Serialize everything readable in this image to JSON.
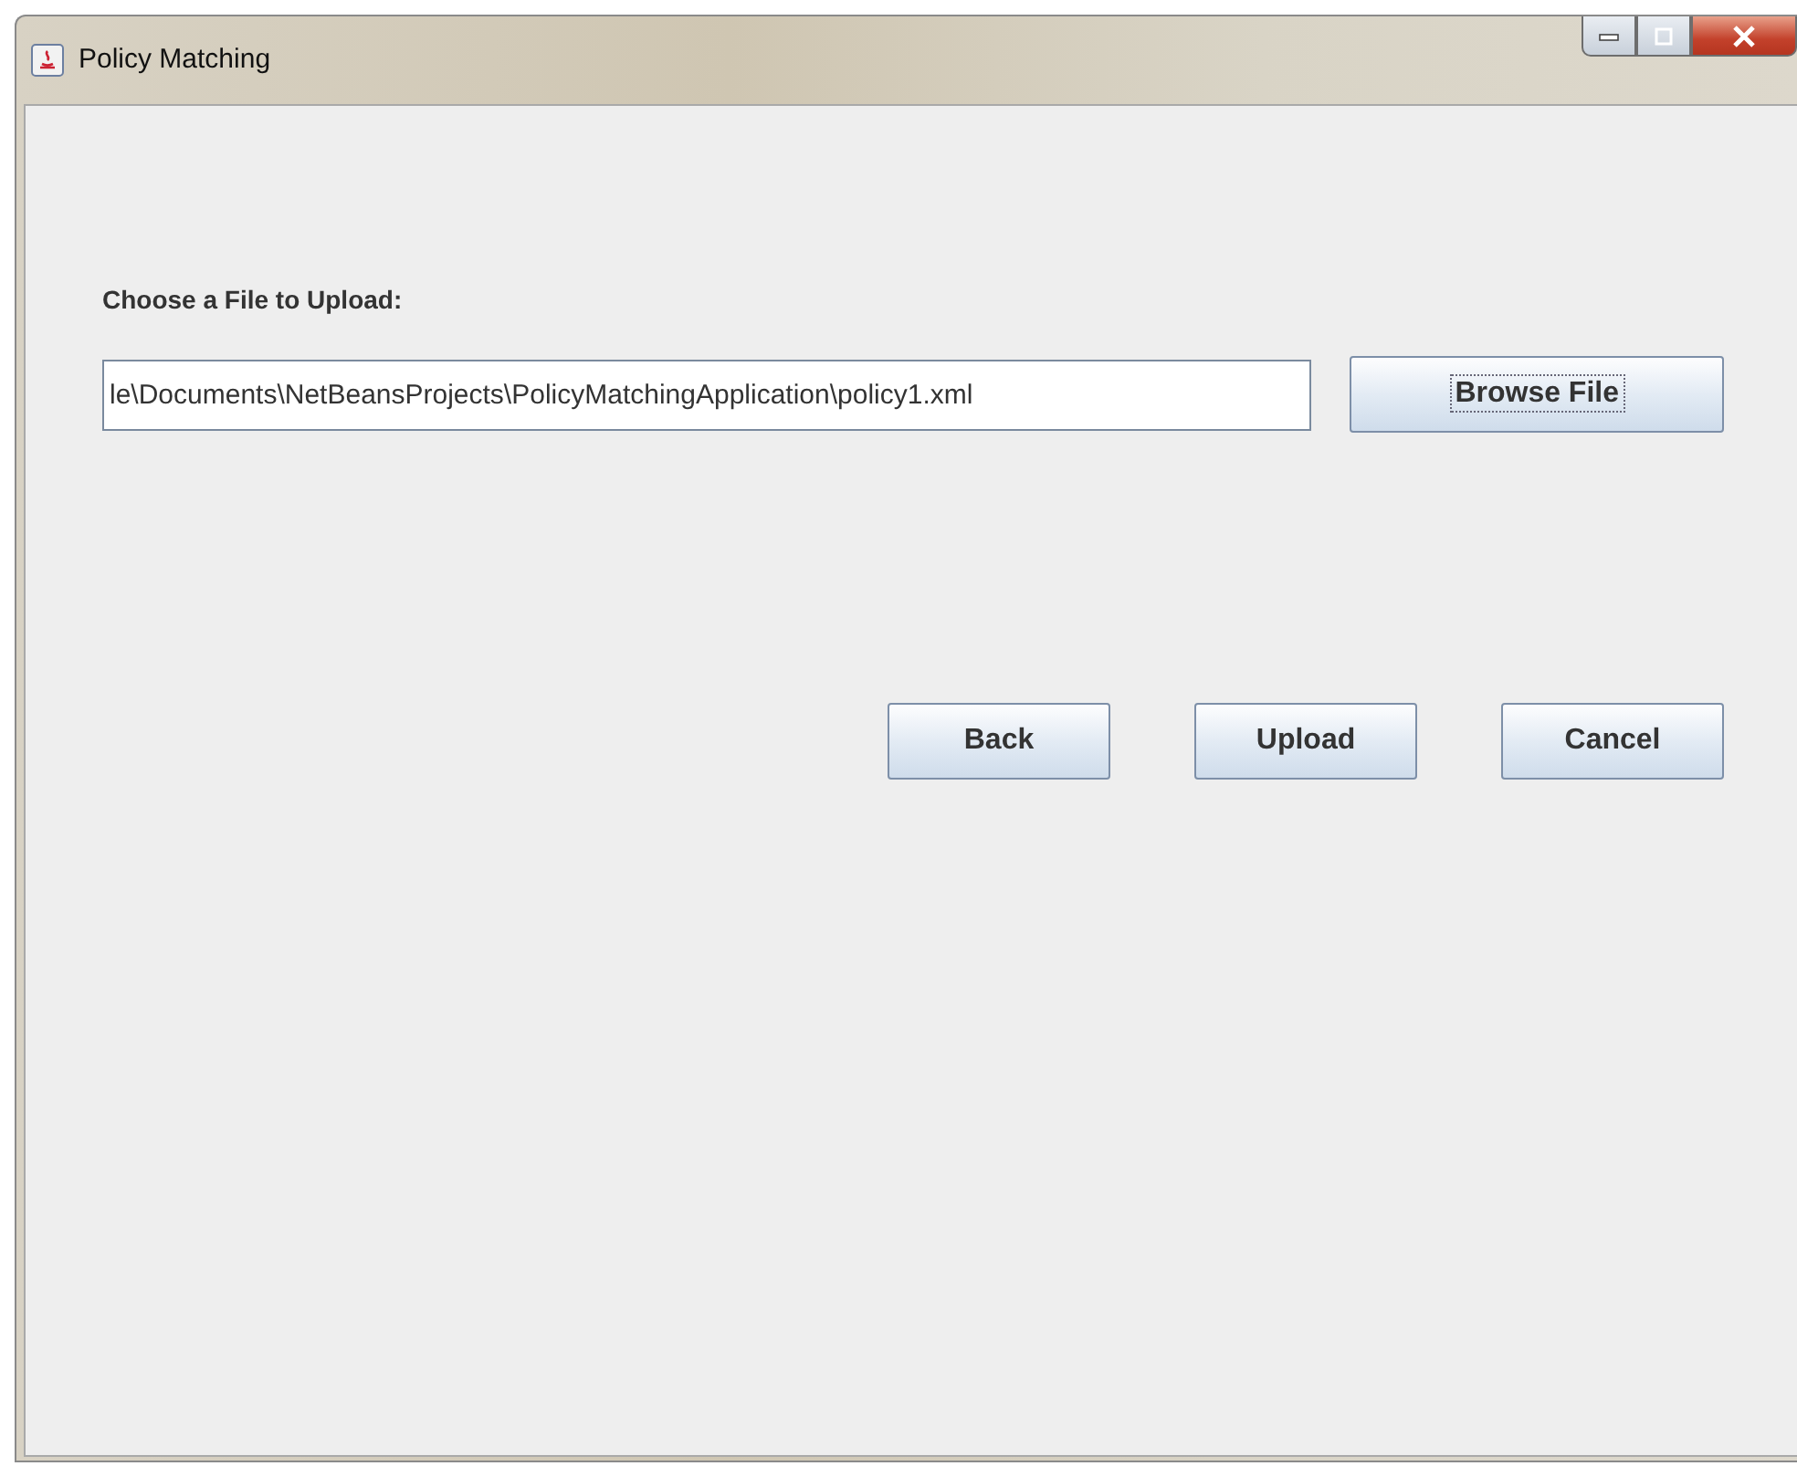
{
  "window": {
    "title": "Policy Matching"
  },
  "label": "Choose a File to Upload:",
  "file_field": {
    "value": "le\\Documents\\NetBeansProjects\\PolicyMatchingApplication\\policy1.xml"
  },
  "browse_button": {
    "label": "Browse File",
    "focused": true
  },
  "buttons": [
    {
      "label": "Back",
      "focused": false
    },
    {
      "label": "Upload",
      "focused": false
    },
    {
      "label": "Cancel",
      "focused": false
    }
  ]
}
